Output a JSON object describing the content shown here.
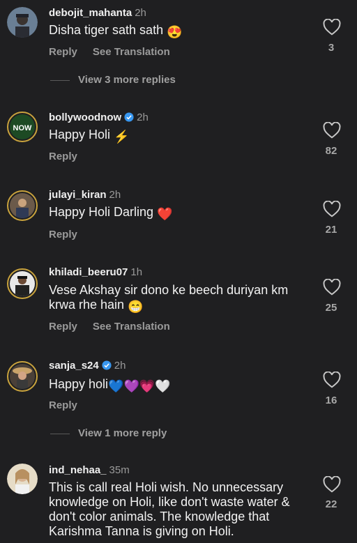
{
  "comments": [
    {
      "username": "debojit_mahanta",
      "time": "2h",
      "verified": false,
      "text": "Disha tiger sath sath",
      "emojis": "😍",
      "reply": "Reply",
      "translate": "See Translation",
      "likes": "3"
    },
    {
      "username": "bollywoodnow",
      "time": "2h",
      "verified": true,
      "text": "Happy Holi",
      "emojis": "⚡",
      "reply": "Reply",
      "likes": "82"
    },
    {
      "username": "julayi_kiran",
      "time": "2h",
      "verified": false,
      "text": "Happy Holi Darling",
      "emojis": "❤️",
      "reply": "Reply",
      "likes": "21"
    },
    {
      "username": "khiladi_beeru07",
      "time": "1h",
      "verified": false,
      "text_line1": "Vese Akshay sir dono ke beech duriyan km",
      "text_line2": "krwa rhe hain",
      "emojis": "😁",
      "reply": "Reply",
      "translate": "See Translation",
      "likes": "25"
    },
    {
      "username": "sanja_s24",
      "time": "2h",
      "verified": true,
      "text": "Happy holi",
      "emojis": "💙💜💗🤍",
      "reply": "Reply",
      "likes": "16"
    },
    {
      "username": "ind_nehaa_",
      "time": "35m",
      "verified": false,
      "text_line1": "This is call real Holi wish. No unnecessary",
      "text_line2": "knowledge on Holi, like don't waste water &",
      "text_line3": "don't color animals. The knowledge that",
      "text_line4": "Karishma Tanna is giving on Holi.",
      "likes": "22"
    }
  ],
  "view_replies": [
    "View 3 more replies",
    "View 1 more reply"
  ],
  "avatar_texts": {
    "bollywoodnow": "NOW"
  },
  "colors": {
    "background": "#1f1f21",
    "verified": "#3897f0",
    "secondary": "#9b9b9b"
  }
}
